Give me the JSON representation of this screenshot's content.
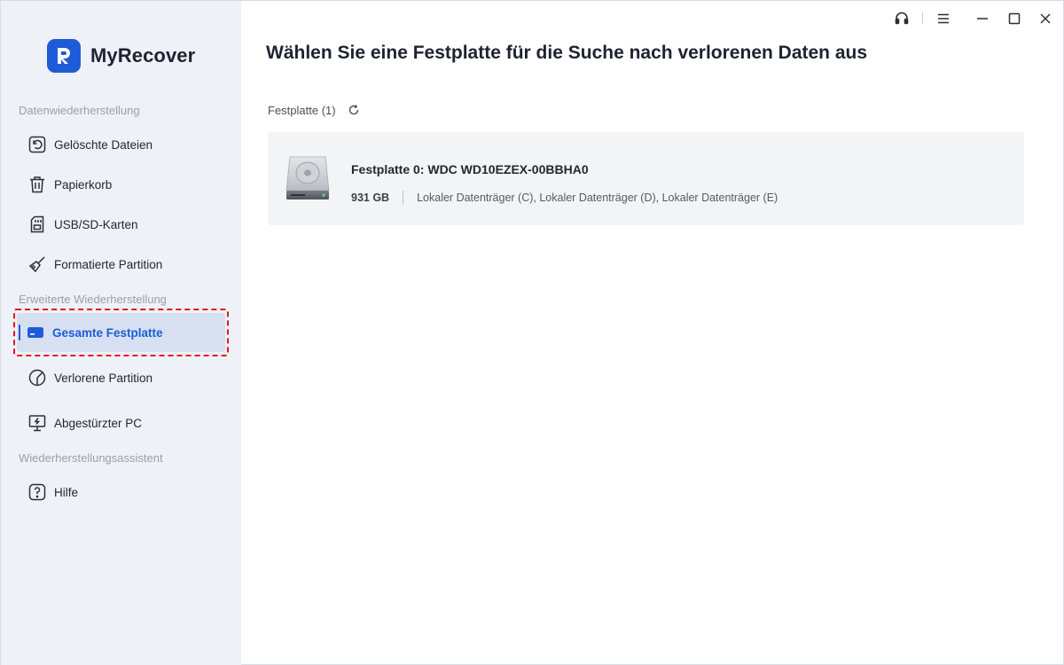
{
  "app": {
    "name": "MyRecover",
    "brand_color": "#1e5bd8"
  },
  "sidebar": {
    "sections": [
      {
        "title": "Datenwiederherstellung",
        "items": [
          {
            "label": "Gelöschte Dateien",
            "icon": "restore-icon"
          },
          {
            "label": "Papierkorb",
            "icon": "trash-icon"
          },
          {
            "label": "USB/SD-Karten",
            "icon": "sd-card-icon"
          },
          {
            "label": "Formatierte Partition",
            "icon": "broom-icon"
          }
        ]
      },
      {
        "title": "Erweiterte Wiederherstellung",
        "items": [
          {
            "label": "Gesamte Festplatte",
            "icon": "hard-drive-icon",
            "active": true
          },
          {
            "label": "Verlorene Partition",
            "icon": "partition-icon"
          },
          {
            "label": "Abgestürzter PC",
            "icon": "crashed-pc-icon"
          }
        ]
      },
      {
        "title": "Wiederherstellungsassistent",
        "items": [
          {
            "label": "Hilfe",
            "icon": "help-icon"
          }
        ]
      }
    ]
  },
  "titlebar": {
    "buttons": [
      "support-icon",
      "menu-icon",
      "minimize-icon",
      "maximize-icon",
      "close-icon"
    ]
  },
  "main": {
    "title": "Wählen Sie eine Festplatte für die Suche nach verlorenen Daten aus",
    "disk_header": "Festplatte (1)",
    "disks": [
      {
        "name": "Festplatte 0: WDC WD10EZEX-00BBHA0",
        "size": "931 GB",
        "partitions": "Lokaler Datenträger (C), Lokaler Datenträger (D), Lokaler Datenträger (E)"
      }
    ]
  },
  "colors": {
    "sidebar_bg": "#eef1f7",
    "active_bg": "#d6e0f0",
    "highlight": "#e0161c",
    "card_bg": "#f3f4f6"
  }
}
